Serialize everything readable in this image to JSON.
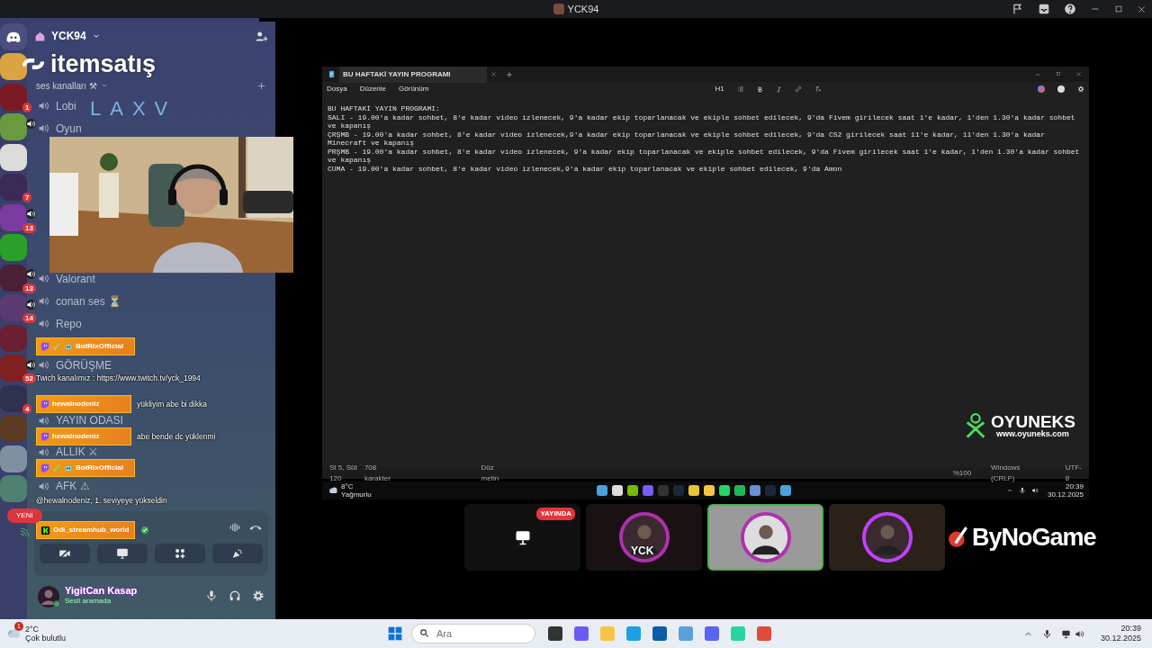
{
  "window": {
    "title": "YCK94"
  },
  "discord": {
    "server_name": "YCK94",
    "category": "ses kanalları ⚒",
    "servers": [
      {
        "color": "#d9a441",
        "speaker": false
      },
      {
        "color": "#7a1a25",
        "speaker": false,
        "badge": "1"
      },
      {
        "color": "#6a9a40",
        "speaker": true
      },
      {
        "color": "#dcdcdc",
        "speaker": false
      },
      {
        "color": "#3a2a55",
        "speaker": false,
        "badge": "7"
      },
      {
        "color": "#7a3aa0",
        "speaker": true,
        "badge": "13"
      },
      {
        "color": "#2aa02a",
        "speaker": false
      },
      {
        "color": "#4a2035",
        "speaker": true,
        "badge": "13"
      },
      {
        "color": "#5a3a70",
        "speaker": true,
        "badge": "14"
      },
      {
        "color": "#6a2030",
        "speaker": false
      },
      {
        "color": "#802020",
        "speaker": true,
        "badge": "52"
      },
      {
        "color": "#303050",
        "speaker": false,
        "badge": "4"
      },
      {
        "color": "#5a3a20",
        "speaker": false
      },
      {
        "color": "#8090a0",
        "speaker": false
      },
      {
        "color": "#508070",
        "speaker": false
      }
    ],
    "new_pill": "YENİ",
    "channels": [
      {
        "name": "Lobi"
      },
      {
        "name": "Oyun"
      },
      {
        "name": "Valorant"
      },
      {
        "name": "conan ses ⏳"
      },
      {
        "name": "Repo"
      },
      {
        "name": "GÖRÜŞME"
      },
      {
        "name": "YAYIN ODASI"
      },
      {
        "name": "ALLIK ⚔"
      },
      {
        "name": "AFK ⚠"
      }
    ],
    "user": {
      "name": "YigitCan Kasap",
      "status": "Sesli aramada"
    }
  },
  "chat": [
    {
      "kind": "badge_user",
      "kick": false,
      "bot": true,
      "user": "BotRixOfficial"
    },
    {
      "kind": "text",
      "text": "Twich kanalımız : https://www.twitch.tv/yck_1994"
    },
    {
      "kind": "message",
      "kick": false,
      "bot": false,
      "user": "hewalnodeniz",
      "text": "yükliyim abe bi dikka"
    },
    {
      "kind": "message",
      "kick": false,
      "bot": false,
      "user": "hewalnodeniz",
      "text": "abe bende dc yüklenmi"
    },
    {
      "kind": "badge_user",
      "kick": false,
      "bot": true,
      "user": "BotRixOfficial"
    },
    {
      "kind": "text",
      "text": "@hewalnodeniz, 1. seviyeye yükseldin"
    },
    {
      "kind": "badge_user",
      "kick": true,
      "bot": false,
      "verified": true,
      "user": "Odi_streamhub_world"
    }
  ],
  "sponsor_logos": [
    {
      "kind": "itemsatis",
      "text": "itemsatış"
    },
    {
      "kind": "laxv",
      "text": "LAXV"
    },
    {
      "kind": "oyuneks",
      "text": "OYUNEKS",
      "url": "www.oyuneks.com"
    },
    {
      "kind": "bynogame",
      "text": "ByNoGame"
    }
  ],
  "notepad": {
    "tab": "BU HAFTAKİ YAYIN PROGRAMI",
    "menu": [
      "Dosya",
      "Düzenle",
      "Görünüm"
    ],
    "heading_button": "H1",
    "lines": [
      "BU HAFTAKİ YAYIN PROGRAMI:",
      "SALI - 19.00'a kadar sohbet, 8'e kadar video izlenecek, 9'a kadar ekip toparlanacak ve ekiple sohbet edilecek, 9'da Fivem girilecek saat 1'e kadar, 1'den 1.30'a kadar sohbet ve kapanış",
      "ÇRŞMB - 19.00'a kadar sohbet, 8'e kadar video izlenecek,9'a kadar ekip toparlanacak ve ekiple sohbet edilecek, 9'da CS2 girilecek saat 11'e kadar, 11'den 1.30'a kadar Minecraft ve kapanış",
      "PRŞMB - 19.00'a kadar sohbet, 8'e kadar video izlenecek, 9'a kadar ekip toparlanacak ve ekiple sohbet edilecek, 9'da Fivem girilecek saat 1'e kadar, 1'den 1.30'a kadar sohbet ve kapanış",
      "CUMA - 19.00'a kadar sohbet, 8'e kadar video izlenecek,9'a kadar ekip toparlanacak ve ekiple sohbet edilecek, 9'da Amon"
    ],
    "status": [
      "St 5, Süt 120",
      "708 karakter",
      "Düz metin",
      "%100",
      "Windows (CRLF)",
      "UTF-8"
    ]
  },
  "stream_taskbar": {
    "temp": "8°C",
    "condition": "Yağmurlu",
    "time": "20:39",
    "date": "30.12.2025"
  },
  "tiles": [
    {
      "kind": "screen",
      "live_label": "YAYINDA",
      "speaking": false
    },
    {
      "kind": "avatar",
      "speaking": false,
      "logo_text": "YCK"
    },
    {
      "kind": "avatar",
      "speaking": true
    },
    {
      "kind": "avatar",
      "speaking": false
    }
  ],
  "taskbar": {
    "temp": "2°C",
    "condition": "Çok bulutlu",
    "weather_badge": "1",
    "search_placeholder": "Ara",
    "time": "20:39",
    "date": "30.12.2025"
  }
}
